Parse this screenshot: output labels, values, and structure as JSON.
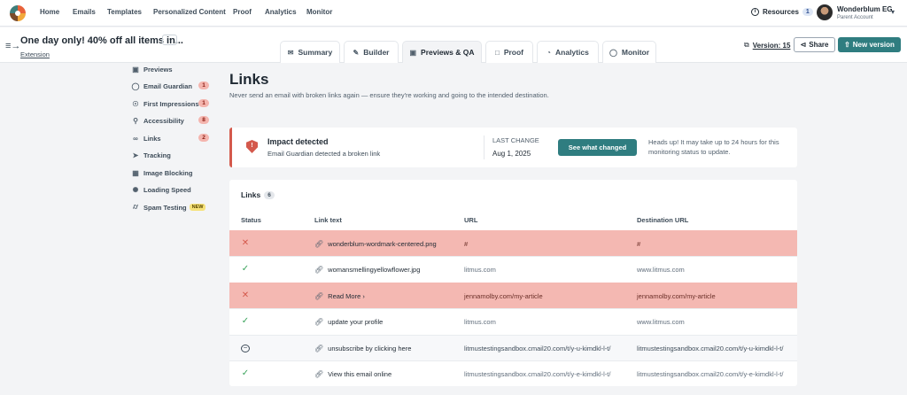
{
  "nav": {
    "items": [
      "Home",
      "Emails",
      "Templates",
      "Personalized Content",
      "Proof",
      "Analytics",
      "Monitor"
    ],
    "resources_label": "Resources",
    "resources_count": "1",
    "account_name": "Wonderblum EG",
    "account_role": "Parent Account"
  },
  "campaign": {
    "title": "One day only! 40% off all items in...",
    "more": "···",
    "subtitle": "Extension"
  },
  "tabs": [
    "Summary",
    "Builder",
    "Previews & QA",
    "Proof",
    "Analytics",
    "Monitor"
  ],
  "active_tab": "Previews & QA",
  "actions": {
    "version_label": "Version: 15",
    "share_label": "Share",
    "new_version_label": "New version"
  },
  "sidebar": {
    "items": [
      {
        "label": "Previews",
        "badge": ""
      },
      {
        "label": "Email Guardian",
        "badge": "1"
      },
      {
        "label": "First Impressions",
        "badge": "1"
      },
      {
        "label": "Accessibility",
        "badge": "8"
      },
      {
        "label": "Links",
        "badge": "2"
      },
      {
        "label": "Tracking",
        "badge": ""
      },
      {
        "label": "Image Blocking",
        "badge": ""
      },
      {
        "label": "Loading Speed",
        "badge": ""
      },
      {
        "label": "Spam Testing",
        "badge": "NEW"
      }
    ]
  },
  "page": {
    "title": "Links",
    "subtitle": "Never send an email with broken links again — ensure they're working and going to the intended destination."
  },
  "alert": {
    "title": "Impact detected",
    "description": "Email Guardian detected a broken link",
    "last_change_label": "LAST CHANGE",
    "last_change_date": "Aug 1, 2025",
    "button_label": "See what changed",
    "note": "Heads up! It may take up to 24 hours for this monitoring status to update."
  },
  "links": {
    "title": "Links",
    "count": "6",
    "columns": [
      "Status",
      "Link text",
      "URL",
      "Destination URL"
    ],
    "rows": [
      {
        "status": "error",
        "text": "wonderblum-wordmark-centered.png",
        "url": "#",
        "dest": "#"
      },
      {
        "status": "ok",
        "text": "womansmellingyellowflower.jpg",
        "url": "litmus.com",
        "dest": "www.litmus.com"
      },
      {
        "status": "error",
        "text": "Read More ›",
        "url": "jennamolby.com/my-article",
        "dest": "jennamolby.com/my-article"
      },
      {
        "status": "ok",
        "text": "update your profile",
        "url": "litmus.com",
        "dest": "www.litmus.com"
      },
      {
        "status": "skip",
        "text": "unsubscribe by clicking here",
        "url": "litmustestingsandbox.cmail20.com/t/y-u-kimdkl-l-t/",
        "dest": "litmustestingsandbox.cmail20.com/t/y-u-kimdkl-l-t/"
      },
      {
        "status": "ok",
        "text": "View this email online",
        "url": "litmustestingsandbox.cmail20.com/t/y-e-kimdkl-l-t/",
        "dest": "litmustestingsandbox.cmail20.com/t/y-e-kimdkl-l-t/"
      }
    ]
  },
  "colors": {
    "brand": "#2f7d80",
    "error_row": "#f4b8b2",
    "alert_accent": "#d4594c"
  }
}
